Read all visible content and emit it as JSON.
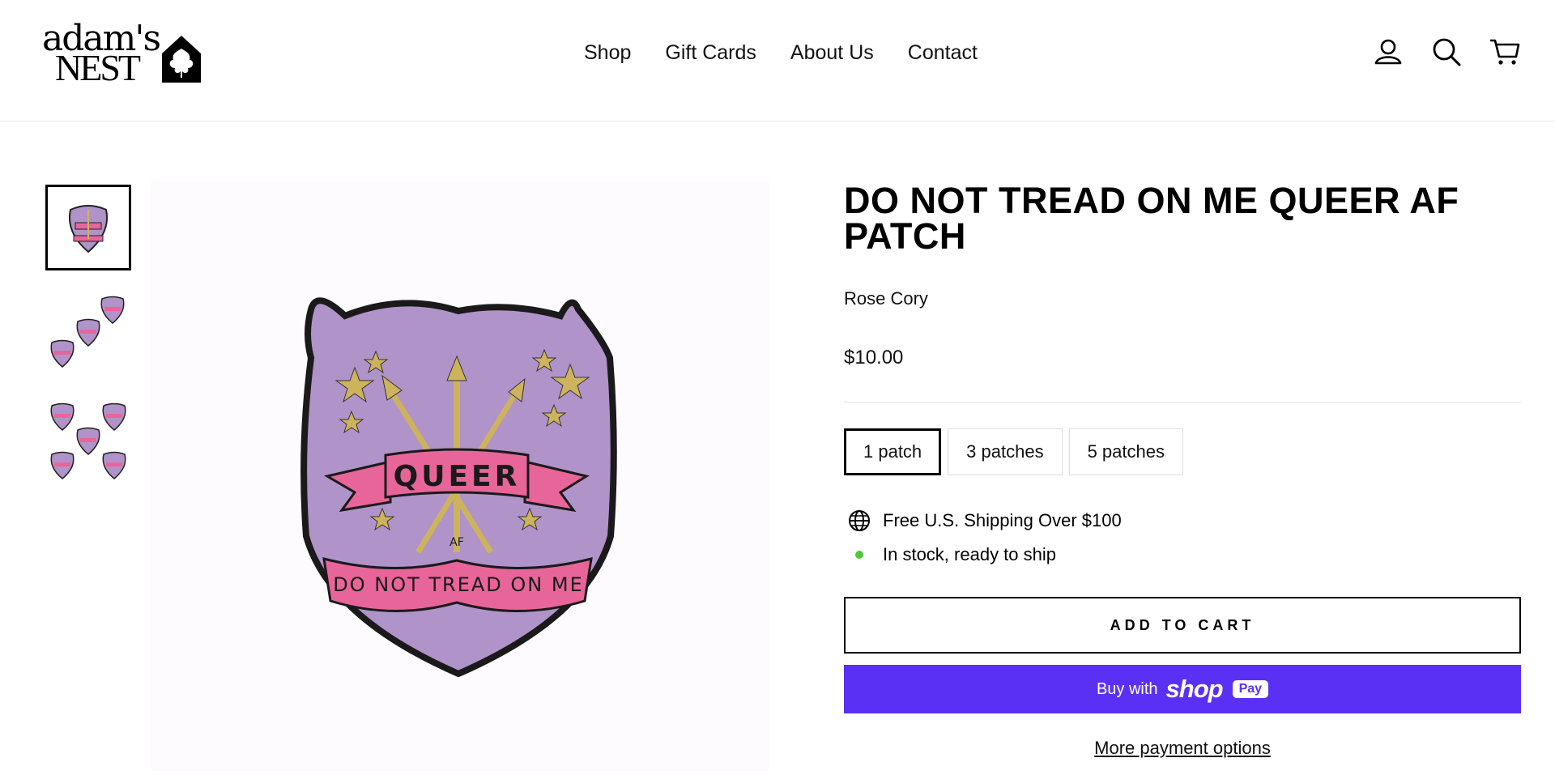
{
  "brand": {
    "logo_line1": "adam's",
    "logo_line2": "NEST",
    "logo_icon": "house-leaf-icon"
  },
  "nav": {
    "items": [
      {
        "label": "Shop"
      },
      {
        "label": "Gift Cards"
      },
      {
        "label": "About Us"
      },
      {
        "label": "Contact"
      }
    ]
  },
  "header_icons": [
    "account-icon",
    "search-icon",
    "cart-icon"
  ],
  "gallery": {
    "thumbnails": [
      {
        "alt": "single patch",
        "count": 1,
        "selected": true
      },
      {
        "alt": "3 patches",
        "count": 3,
        "selected": false
      },
      {
        "alt": "5 patches",
        "count": 5,
        "selected": false
      }
    ],
    "main_image": {
      "banner_text": "QUEER",
      "small_text": "AF",
      "bottom_text": "DO NOT TREAD ON ME"
    }
  },
  "product": {
    "title": "DO NOT TREAD ON ME QUEER AF PATCH",
    "vendor": "Rose Cory",
    "price": "$10.00",
    "variants": [
      {
        "label": "1 patch",
        "selected": true
      },
      {
        "label": "3 patches",
        "selected": false
      },
      {
        "label": "5 patches",
        "selected": false
      }
    ],
    "shipping_note": "Free U.S. Shipping Over $100",
    "stock_note": "In stock, ready to ship",
    "add_to_cart": "ADD TO CART",
    "shop_pay": {
      "buy_with": "Buy with",
      "shop": "shop",
      "pay": "Pay"
    },
    "more_payment": "More payment options"
  },
  "colors": {
    "shop_pay": "#5a31f4",
    "stock_dot": "#54c63a",
    "patch_purple": "#b093c9",
    "patch_pink": "#e8659a",
    "patch_gold": "#cdb35c"
  }
}
